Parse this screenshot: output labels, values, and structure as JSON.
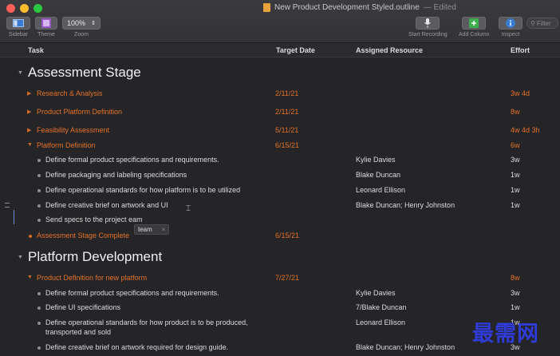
{
  "window": {
    "title": "New Product Development Styled.outline",
    "status": "— Edited"
  },
  "toolbar": {
    "sidebar_label": "Sidebar",
    "theme_label": "Theme",
    "zoom_value": "100%",
    "zoom_label": "Zoom",
    "start_recording_label": "Start Recording",
    "add_column_label": "Add Column",
    "inspect_label": "Inspect",
    "filter_placeholder": "Filter"
  },
  "columns": {
    "task": "Task",
    "target_date": "Target Date",
    "assigned": "Assigned Resource",
    "effort": "Effort"
  },
  "rows": [
    {
      "kind": "section",
      "task": "Assessment Stage",
      "date": "",
      "resource": "",
      "effort": ""
    },
    {
      "kind": "orange-collapsed",
      "task": "Research & Analysis",
      "date": "2/11/21",
      "resource": "",
      "effort": "3w 4d"
    },
    {
      "kind": "orange-collapsed",
      "task": "Product Platform Definition",
      "date": "2/11/21",
      "resource": "",
      "effort": "8w"
    },
    {
      "kind": "orange-collapsed",
      "task": "Feasibility Assessment",
      "date": "5/11/21",
      "resource": "",
      "effort": "4w 4d 3h"
    },
    {
      "kind": "orange-expanded",
      "task": "Platform Definition",
      "date": "6/15/21",
      "resource": "",
      "effort": "6w"
    },
    {
      "kind": "plain",
      "task": "Define formal product specifications and requirements.",
      "date": "",
      "resource": "Kylie Davies",
      "effort": "3w"
    },
    {
      "kind": "plain",
      "task": "Define packaging and labeling specifications",
      "date": "",
      "resource": "Blake Duncan",
      "effort": "1w"
    },
    {
      "kind": "plain",
      "task": "Define operational standards for how platform is to be utilized",
      "date": "",
      "resource": "Leonard Ellison",
      "effort": "1w"
    },
    {
      "kind": "plain",
      "task": "Define creative brief on artwork and UI",
      "date": "",
      "resource": "Blake Duncan; Henry Johnston",
      "effort": "1w"
    },
    {
      "kind": "plain",
      "task": "Send specs to the project eam",
      "date": "",
      "resource": "",
      "effort": ""
    },
    {
      "kind": "orange-bullet",
      "task": "Assessment Stage Complete",
      "date": "6/15/21",
      "resource": "",
      "effort": ""
    },
    {
      "kind": "section",
      "task": "Platform Development",
      "date": "",
      "resource": "",
      "effort": ""
    },
    {
      "kind": "orange-expanded",
      "task": "Product Definition for new platform",
      "date": "7/27/21",
      "resource": "",
      "effort": "8w"
    },
    {
      "kind": "plain",
      "task": "Define formal product specifications and requirements.",
      "date": "",
      "resource": "Kylie Davies",
      "effort": "3w"
    },
    {
      "kind": "plain",
      "task": "Define UI specifications",
      "date": "",
      "resource": "7/Blake Duncan",
      "effort": "1w"
    },
    {
      "kind": "plain",
      "task": "Define operational standards for how product is to be produced,",
      "task2": "transported and sold",
      "date": "",
      "resource": "Leonard Ellison",
      "effort": "1w"
    },
    {
      "kind": "plain",
      "task": "Define creative brief on artwork required for design guide.",
      "date": "",
      "resource": "Blake Duncan; Henry Johnston",
      "effort": "3w"
    }
  ],
  "autocomplete": {
    "suggestion": "team",
    "close": "×"
  },
  "watermark": "最需网"
}
